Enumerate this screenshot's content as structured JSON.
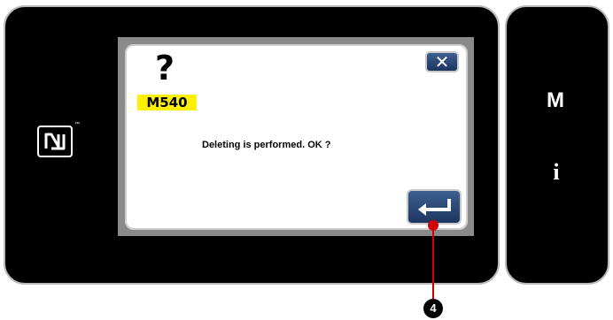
{
  "dialog": {
    "icon": "question-mark-icon",
    "question_mark": "?",
    "code": "M540",
    "message": "Deleting is performed. OK ?",
    "close_icon": "close-icon",
    "close_glyph": "✕",
    "enter_icon": "enter-return-icon"
  },
  "side_panel": {
    "menu_label": "M",
    "info_label": "i"
  },
  "nfc": {
    "icon": "nfc-icon",
    "tm": "™"
  },
  "callout": {
    "number": "4"
  },
  "colors": {
    "code_bg": "#ffef00",
    "button_bg": "#2b4a7c",
    "callout": "#d40000"
  }
}
